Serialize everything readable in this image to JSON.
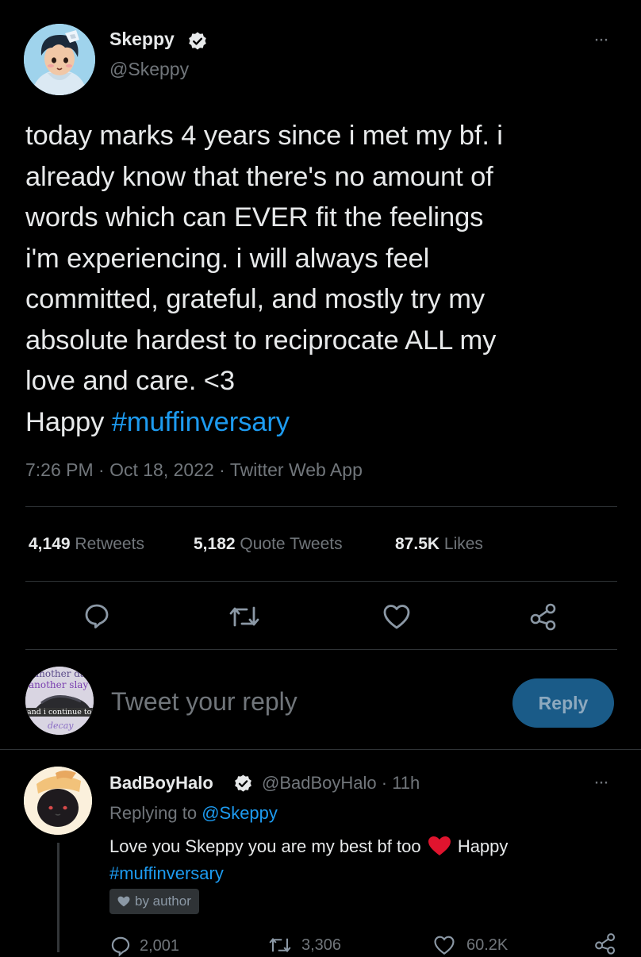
{
  "tweet": {
    "author_name": "Skeppy",
    "author_handle": "@Skeppy",
    "more": "···",
    "lines": [
      "today marks 4 years since i met my bf. i",
      "already know that there's no amount of",
      "words which can EVER fit the feelings",
      "i'm experiencing. i will always feel",
      "committed, grateful, and mostly try my",
      "absolute hardest to reciprocate ALL my",
      "love and care. <3"
    ],
    "last_line_prefix": "Happy ",
    "hashtag": "#muffinversary",
    "meta": "7:26 PM · Oct 18, 2022 · Twitter Web App",
    "stats": {
      "retweets_count": "4,149",
      "retweets_label": "Retweets",
      "quotes_count": "5,182",
      "quotes_label": "Quote Tweets",
      "likes_count": "87.5K",
      "likes_label": "Likes"
    },
    "actions": [
      "reply-icon",
      "retweet-icon",
      "like-icon",
      "share-icon"
    ]
  },
  "composer": {
    "placeholder": "Tweet your reply",
    "button_label": "Reply",
    "button_color": "#1a5b88",
    "avatar_texts": [
      "another day",
      "another slay",
      "and i continue to",
      "decay"
    ]
  },
  "reply": {
    "author_name": "BadBoyHalo",
    "author_handle": "@BadBoyHalo",
    "time": "· 11h",
    "replying_prefix": "Replying to ",
    "replying_handle": "@Skeppy",
    "text_before_heart": "Love you Skeppy you are my best bf too",
    "text_after_heart": "Happy",
    "hashtag": "#muffinversary",
    "liked_by": "by author",
    "counts": {
      "replies": "2,001",
      "retweets": "3,306",
      "likes": "60.2K"
    }
  },
  "colors": {
    "accent": "#1d9bf0",
    "background": "#000000",
    "heart": "#f91880"
  }
}
